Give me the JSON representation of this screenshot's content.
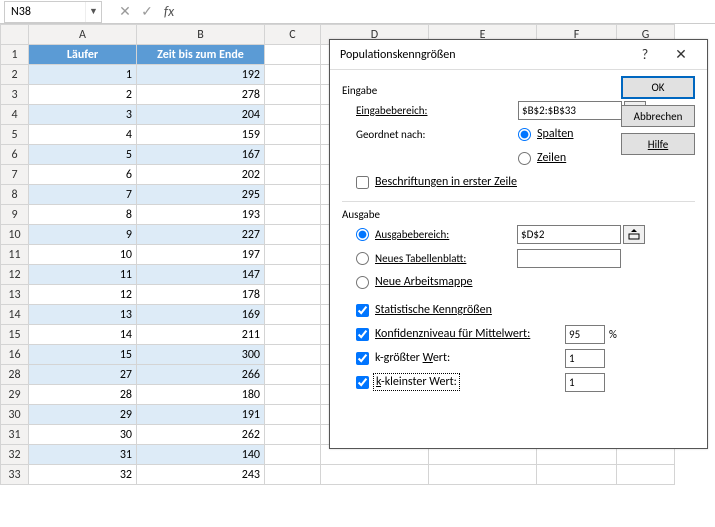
{
  "chart_data": {
    "type": "table",
    "columns": [
      "Läufer",
      "Zeit bis zum Ende"
    ],
    "rows": [
      [
        1,
        192
      ],
      [
        2,
        278
      ],
      [
        3,
        204
      ],
      [
        4,
        159
      ],
      [
        5,
        167
      ],
      [
        6,
        202
      ],
      [
        7,
        295
      ],
      [
        8,
        193
      ],
      [
        9,
        227
      ],
      [
        10,
        197
      ],
      [
        11,
        147
      ],
      [
        12,
        178
      ],
      [
        13,
        169
      ],
      [
        14,
        211
      ],
      [
        15,
        300
      ],
      [
        27,
        266
      ],
      [
        28,
        180
      ],
      [
        29,
        191
      ],
      [
        30,
        262
      ],
      [
        31,
        140
      ],
      [
        32,
        243
      ]
    ]
  },
  "namebox": {
    "value": "N38",
    "fx_label": "fx"
  },
  "columns": [
    "A",
    "B",
    "C",
    "D",
    "E",
    "F",
    "G"
  ],
  "row_numbers": [
    1,
    2,
    3,
    4,
    5,
    6,
    7,
    8,
    9,
    10,
    11,
    12,
    13,
    14,
    15,
    28,
    29,
    30,
    31,
    32,
    33
  ],
  "headers": {
    "A": "Läufer",
    "B": "Zeit bis zum Ende"
  },
  "data": [
    {
      "r": 2,
      "a": 1,
      "b": 192
    },
    {
      "r": 3,
      "a": 2,
      "b": 278
    },
    {
      "r": 4,
      "a": 3,
      "b": 204
    },
    {
      "r": 5,
      "a": 4,
      "b": 159
    },
    {
      "r": 6,
      "a": 5,
      "b": 167
    },
    {
      "r": 7,
      "a": 6,
      "b": 202
    },
    {
      "r": 8,
      "a": 7,
      "b": 295
    },
    {
      "r": 9,
      "a": 8,
      "b": 193
    },
    {
      "r": 10,
      "a": 9,
      "b": 227
    },
    {
      "r": 11,
      "a": 10,
      "b": 197
    },
    {
      "r": 12,
      "a": 11,
      "b": 147
    },
    {
      "r": 13,
      "a": 12,
      "b": 178
    },
    {
      "r": 14,
      "a": 13,
      "b": 169
    },
    {
      "r": 15,
      "a": 14,
      "b": 211
    },
    {
      "r": 16,
      "a": 15,
      "b": 300
    },
    {
      "r": 28,
      "a": 27,
      "b": 266
    },
    {
      "r": 29,
      "a": 28,
      "b": 180
    },
    {
      "r": 30,
      "a": 29,
      "b": 191
    },
    {
      "r": 31,
      "a": 30,
      "b": 262
    },
    {
      "r": 32,
      "a": 31,
      "b": 140
    },
    {
      "r": 33,
      "a": 32,
      "b": 243
    }
  ],
  "dialog": {
    "title": "Populationskenngrößen",
    "help_glyph": "?",
    "close_glyph": "✕",
    "section_input": "Eingabe",
    "input_range_label": "Eingabebereich:",
    "input_range_value": "$B$2:$B$33",
    "grouped_label": "Geordnet nach:",
    "grouped_cols": "Spalten",
    "grouped_rows": "Zeilen",
    "labels_first_row": "Beschriftungen in erster Zeile",
    "section_output": "Ausgabe",
    "output_range_label": "Ausgabebereich:",
    "output_range_value": "$D$2",
    "new_sheet_label": "Neues Tabellenblatt:",
    "new_sheet_value": "",
    "new_workbook_label": "Neue Arbeitsmappe",
    "summary_stats_label": "Statistische Kenngrößen",
    "confidence_label": "Konfidenzniveau für Mittelwert:",
    "confidence_value": "95",
    "pct": "%",
    "kth_largest_label": "k-größter Wert:",
    "kth_largest_value": "1",
    "kth_smallest_label": "k-kleinster Wert:",
    "kth_smallest_value": "1",
    "btn_ok": "OK",
    "btn_cancel": "Abbrechen",
    "btn_help": "Hilfe"
  }
}
